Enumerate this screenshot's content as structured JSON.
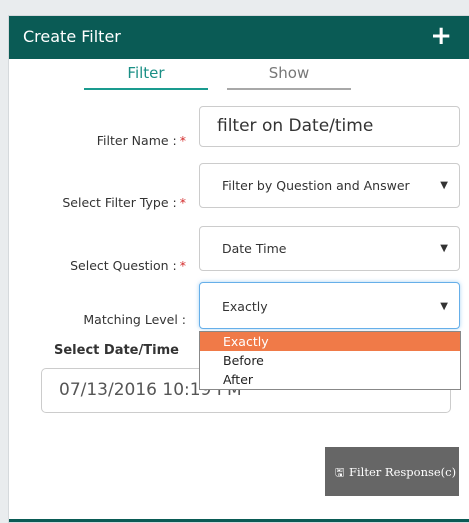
{
  "header": {
    "title": "Create Filter",
    "add_icon": "plus-icon",
    "add_glyph": "+"
  },
  "tabs": [
    {
      "label": "Filter",
      "active": true
    },
    {
      "label": "Show",
      "active": false
    }
  ],
  "form": {
    "filter_name": {
      "label": "Filter Name :",
      "required_mark": "*",
      "value": "filter on Date/time"
    },
    "filter_type": {
      "label": "Select Filter Type :",
      "required_mark": "*",
      "value": "Filter by Question and Answer"
    },
    "question": {
      "label": "Select Question :",
      "required_mark": "*",
      "value": "Date Time"
    },
    "matching_level": {
      "label": "Matching Level :",
      "value": "Exactly",
      "options": [
        "Exactly",
        "Before",
        "After"
      ],
      "highlighted_option": "Exactly"
    },
    "date_time": {
      "label": "Select Date/Time",
      "value": "07/13/2016 10:19 PM"
    }
  },
  "footer": {
    "filter_button_label": "Filter Response(c)",
    "filter_button_icon": "save-icon"
  },
  "colors": {
    "header_bg": "#0a5b55",
    "tab_active": "#1a9b8f",
    "required": "#d42d2d",
    "dropdown_highlight": "#f07a48",
    "button_bg": "#666666"
  }
}
